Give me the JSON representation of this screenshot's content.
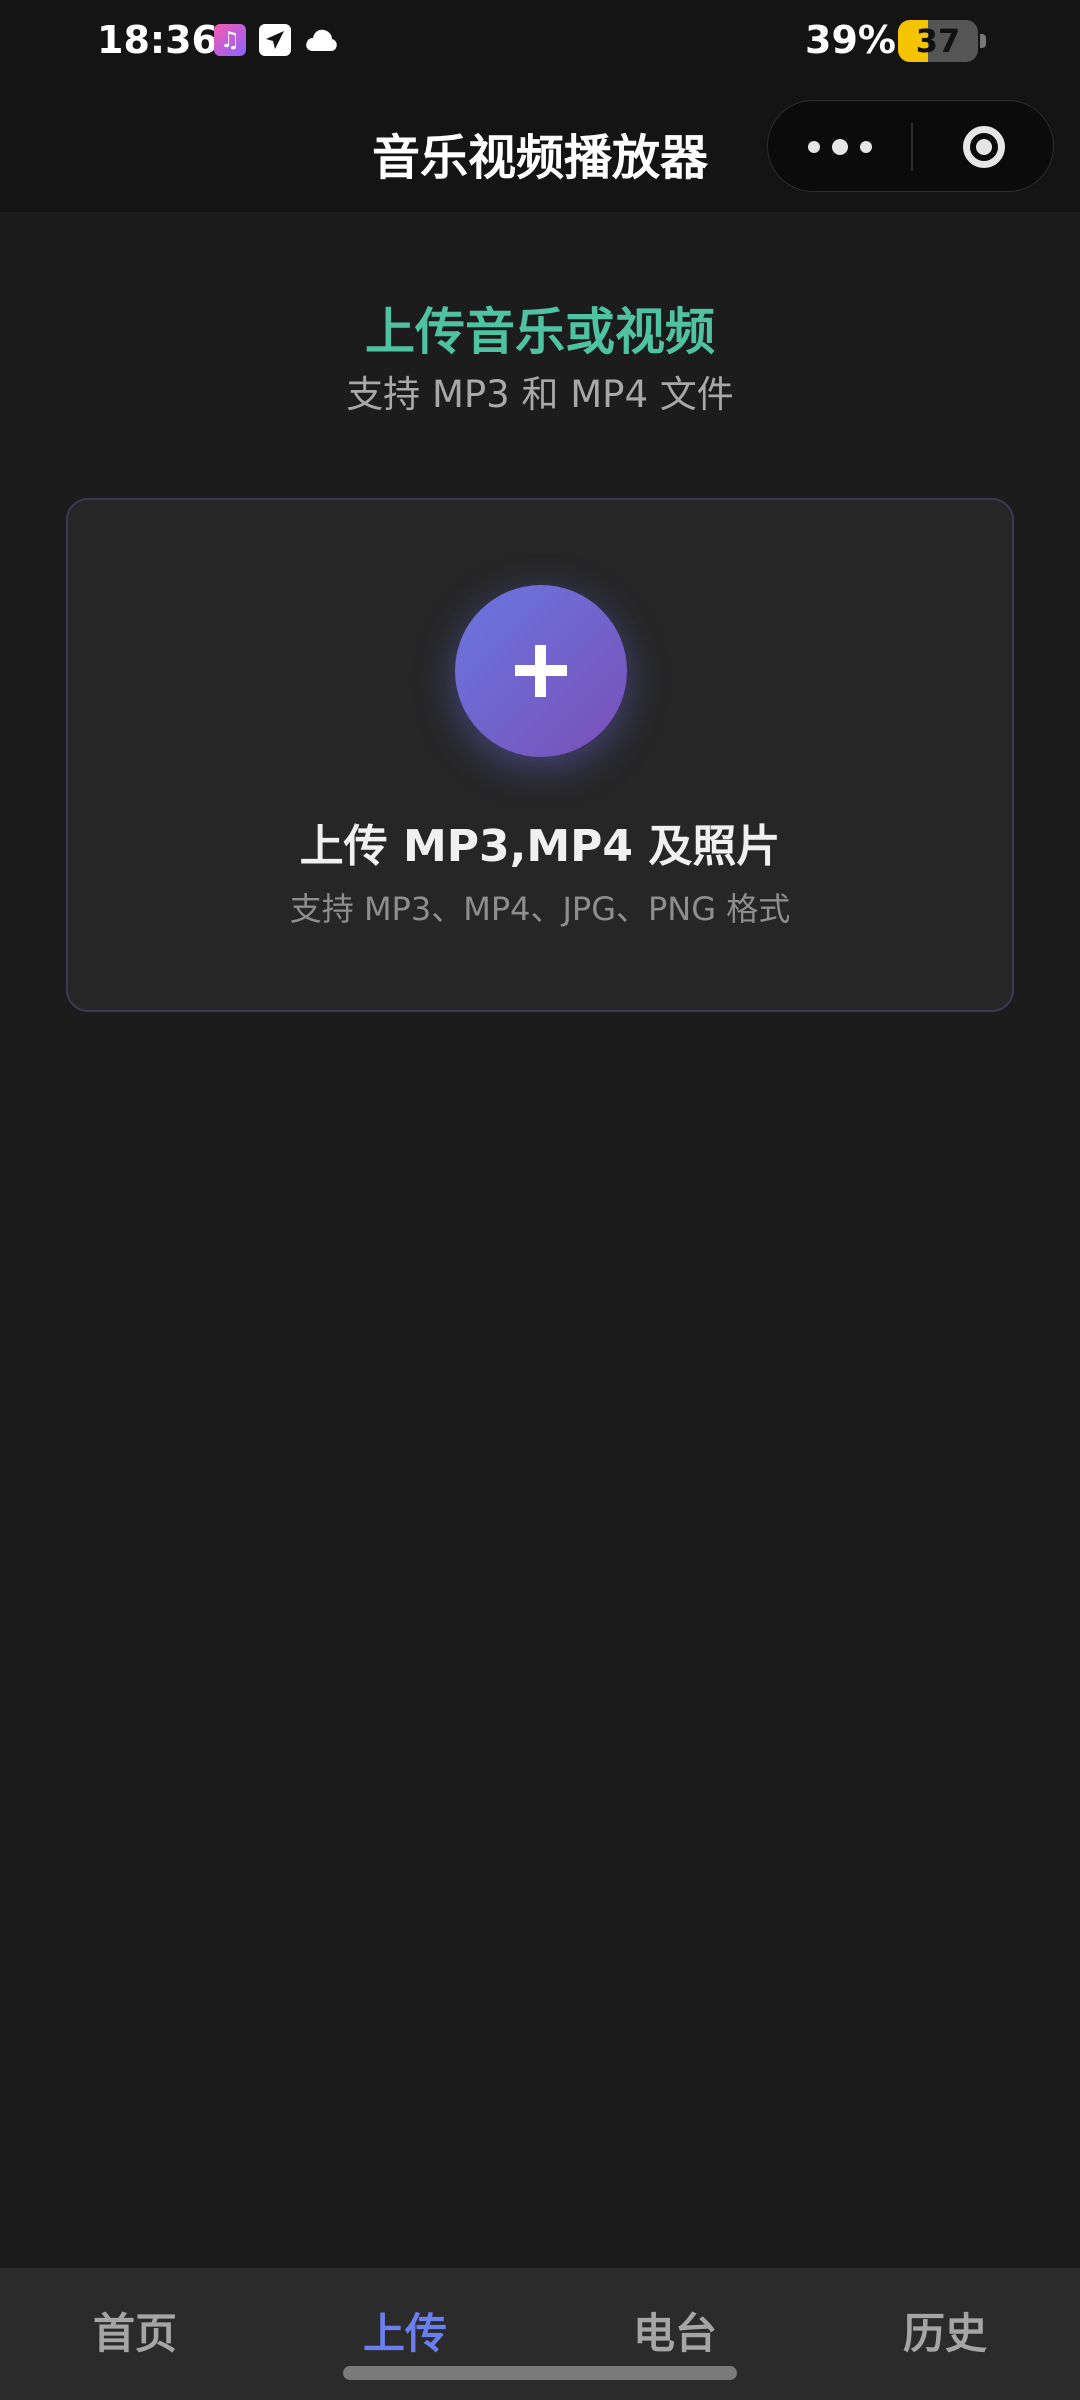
{
  "status_bar": {
    "time": "18:36",
    "battery_percent": "39%",
    "battery_level": "37",
    "battery_fill_fraction": 0.38,
    "icons": [
      "music-app-icon",
      "send-icon",
      "cloud-icon"
    ]
  },
  "nav": {
    "title": "音乐视频播放器"
  },
  "header": {
    "title": "上传音乐或视频",
    "subtitle": "支持 MP3 和 MP4 文件"
  },
  "upload_card": {
    "button_symbol": "+",
    "title": "上传 MP3,MP4 及照片",
    "description": "支持 MP3、MP4、JPG、PNG 格式"
  },
  "tabs": [
    {
      "label": "首页",
      "active": false
    },
    {
      "label": "上传",
      "active": true
    },
    {
      "label": "电台",
      "active": false
    },
    {
      "label": "历史",
      "active": false
    }
  ],
  "colors": {
    "accent_teal": "#4fc3a1",
    "accent_purple": "#6b7ef0",
    "background": "#1c1c1c"
  }
}
